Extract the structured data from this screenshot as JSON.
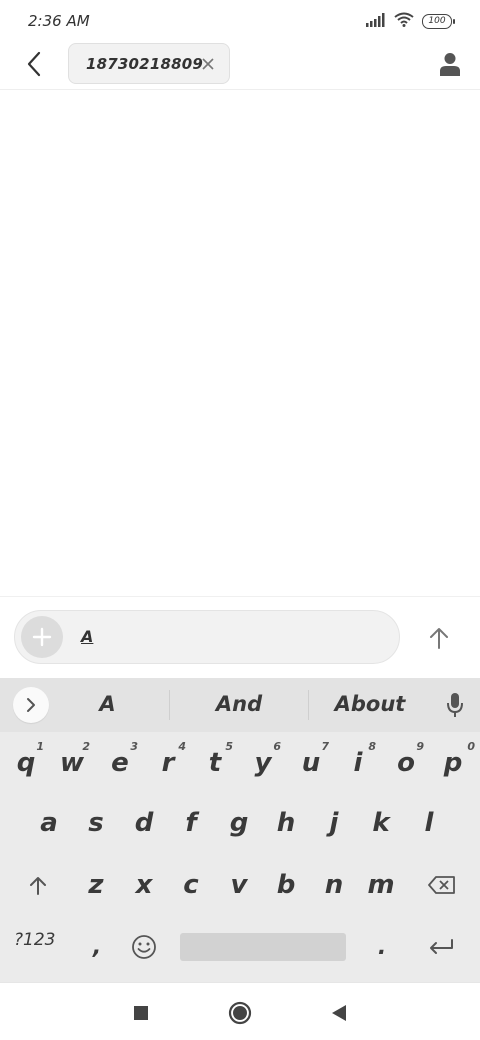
{
  "status_bar": {
    "time": "2:36 AM",
    "battery": "100",
    "signal_icon": "signal-bars-icon",
    "wifi_icon": "wifi-icon"
  },
  "header": {
    "back_icon": "back-arrow-icon",
    "recipient": "18730218809",
    "remove_icon": "close-icon",
    "contact_icon": "person-icon"
  },
  "compose": {
    "text": "A",
    "attach_icon": "plus-icon",
    "send_icon": "send-arrow-icon"
  },
  "keyboard": {
    "suggestions": [
      "A",
      "And",
      "About"
    ],
    "expand_icon": "chevron-right-icon",
    "mic_icon": "microphone-icon",
    "row1": [
      {
        "key": "q",
        "hint": "1"
      },
      {
        "key": "w",
        "hint": "2"
      },
      {
        "key": "e",
        "hint": "3"
      },
      {
        "key": "r",
        "hint": "4"
      },
      {
        "key": "t",
        "hint": "5"
      },
      {
        "key": "y",
        "hint": "6"
      },
      {
        "key": "u",
        "hint": "7"
      },
      {
        "key": "i",
        "hint": "8"
      },
      {
        "key": "o",
        "hint": "9"
      },
      {
        "key": "p",
        "hint": "0"
      }
    ],
    "row2": [
      "a",
      "s",
      "d",
      "f",
      "g",
      "h",
      "j",
      "k",
      "l"
    ],
    "row3": [
      "z",
      "x",
      "c",
      "v",
      "b",
      "n",
      "m"
    ],
    "symbols_label": "?123",
    "comma": ",",
    "period": ".",
    "shift_icon": "shift-arrow-icon",
    "backspace_icon": "backspace-icon",
    "emoji_icon": "emoji-icon",
    "enter_icon": "enter-icon"
  },
  "nav_bar": {
    "recents_icon": "square-icon",
    "home_icon": "circle-icon",
    "back_icon": "triangle-back-icon"
  },
  "colors": {
    "keyboard_bg": "#ebebeb",
    "suggestion_bg": "#e3e3e3",
    "chip_bg": "#f2f2f2",
    "text": "#333333"
  }
}
